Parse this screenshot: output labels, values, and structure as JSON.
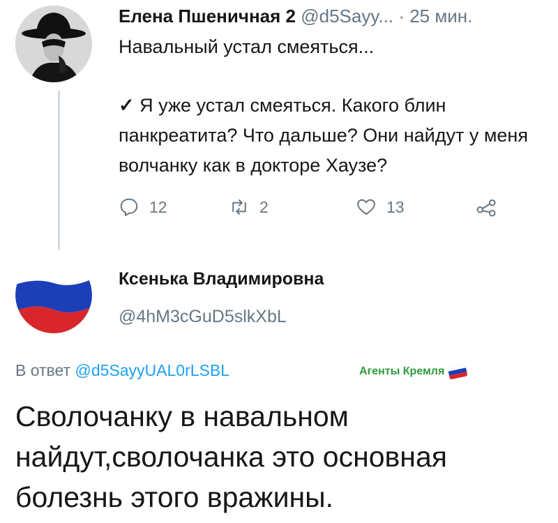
{
  "tweet1": {
    "author_name": "Елена Пшеничная 2",
    "handle": "@d5Sayy...",
    "separator": "·",
    "time": "25 мин.",
    "title_text": "Навальный устал смеяться...",
    "check_mark": "✓",
    "body_text": "Я уже устал смеяться. Какого блин панкреатита? Что дальше? Они найдут у меня волчанку как в докторе Хаузе?",
    "actions": {
      "replies": "12",
      "retweets": "2",
      "likes": "13"
    }
  },
  "tweet2": {
    "author_name": "Ксенька Владимировна",
    "handle": "@4hM3cGuD5slkXbL",
    "reply_prefix": "В ответ",
    "reply_to": "@d5SayyUAL0rLSBL",
    "watermark": "Агенты Кремля",
    "body_text": "Сволочанку в навальном найдут,сволочанка это основная болезнь этого вражины."
  },
  "colors": {
    "text": "#14171a",
    "secondary": "#657786",
    "link": "#1da1f2",
    "watermark": "#2e9a3a",
    "flag_white": "#ffffff",
    "flag_blue": "#1c3fb8",
    "flag_red": "#d8262c"
  }
}
